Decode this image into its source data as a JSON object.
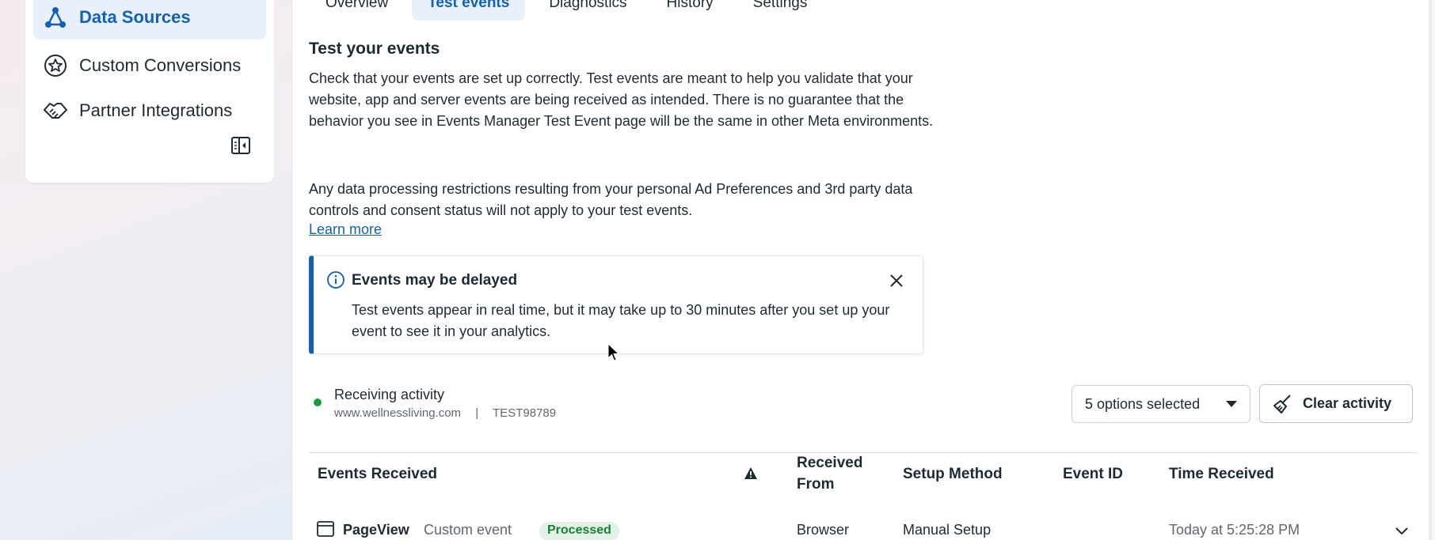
{
  "sidebar": {
    "items": [
      {
        "label": "Data Sources",
        "icon": "data-sources-icon",
        "active": true
      },
      {
        "label": "Custom Conversions",
        "icon": "star-badge-icon",
        "active": false
      },
      {
        "label": "Partner Integrations",
        "icon": "handshake-icon",
        "active": false
      }
    ]
  },
  "tabs": [
    "Overview",
    "Test events",
    "Diagnostics",
    "History",
    "Settings"
  ],
  "active_tab": "Test events",
  "main": {
    "title": "Test your events",
    "para1": "Check that your events are set up correctly. Test events are meant to help you validate that your website, app and server events are being received as intended. There is no guarantee that the behavior you see in Events Manager Test Event page will be the same in other Meta environments.",
    "para2": "Any data processing restrictions resulting from your personal Ad Preferences and 3rd party data controls and consent status will not apply to your test events.",
    "learn_more": "Learn more"
  },
  "banner": {
    "title": "Events may be delayed",
    "text": "Test events appear in real time, but it may take up to 30 minutes after you set up your event to see it in your analytics."
  },
  "activity": {
    "status": "Receiving activity",
    "domain": "www.wellnessliving.com",
    "separator": "|",
    "test_code": "TEST98789",
    "status_color": "#1a9c3e"
  },
  "controls": {
    "options_label": "5 options selected",
    "clear_label": "Clear activity"
  },
  "table": {
    "headers": {
      "events": "Events Received",
      "received_line1": "Received",
      "received_line2": "From",
      "setup": "Setup Method",
      "event_id": "Event ID",
      "time": "Time Received"
    },
    "rows": [
      {
        "event": "PageView",
        "type": "Custom event",
        "status": "Processed",
        "received_from": "Browser",
        "setup_method": "Manual Setup",
        "event_id": "",
        "time": "Today at 5:25:28 PM"
      }
    ]
  },
  "colors": {
    "accent": "#1261b5",
    "active_bg": "#e7f0fb",
    "success": "#1a7f37"
  }
}
